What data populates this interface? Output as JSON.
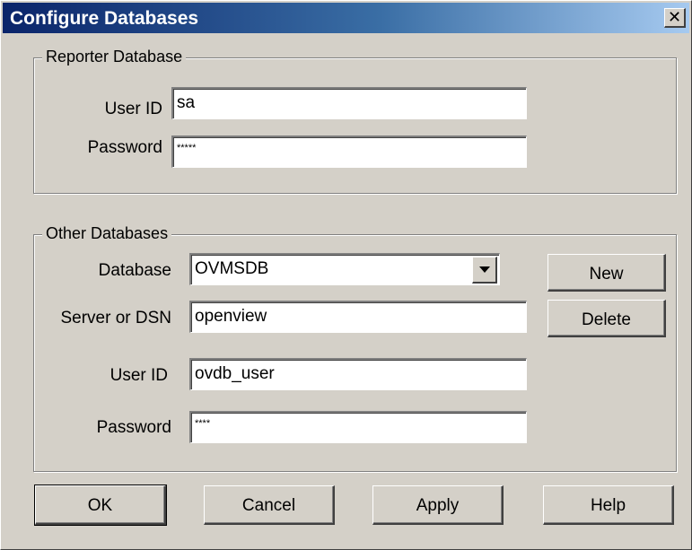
{
  "window": {
    "title": "Configure Databases"
  },
  "reporter": {
    "group_label": "Reporter Database",
    "user_id_label": "User ID",
    "user_id_value": "sa",
    "password_label": "Password",
    "password_value": "*****"
  },
  "other": {
    "group_label": "Other Databases",
    "database_label": "Database",
    "database_value": "OVMSDB",
    "server_label": "Server or DSN",
    "server_value": "openview",
    "user_id_label": "User ID",
    "user_id_value": "ovdb_user",
    "password_label": "Password",
    "password_value": "****",
    "new_label": "New",
    "delete_label": "Delete"
  },
  "buttons": {
    "ok": "OK",
    "cancel": "Cancel",
    "apply": "Apply",
    "help": "Help"
  },
  "icons": {
    "close": "close-icon",
    "dropdown": "chevron-down-icon"
  }
}
